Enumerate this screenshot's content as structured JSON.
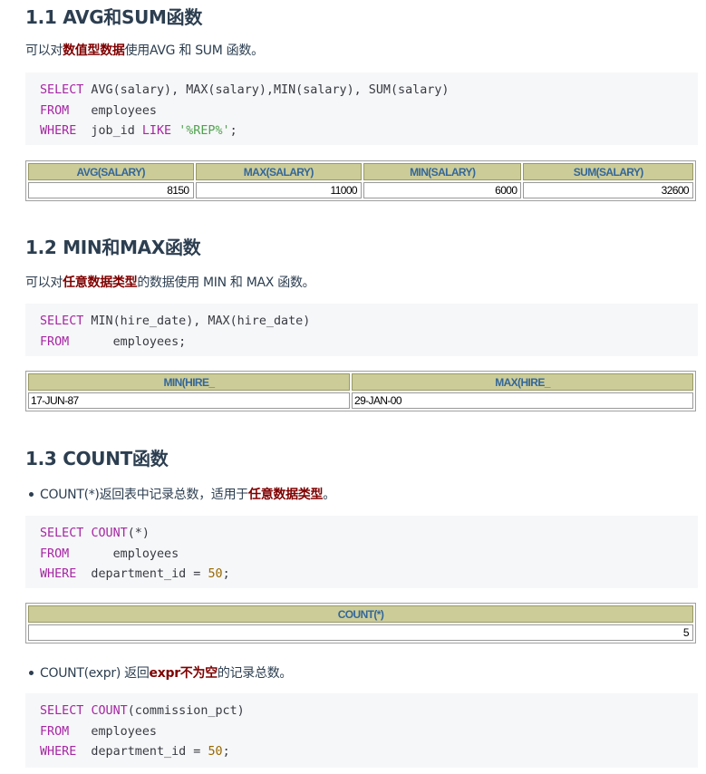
{
  "s1": {
    "heading": "1.1 AVG和SUM函数",
    "para_pre": "可以对",
    "para_hl": "数值型数据",
    "para_post": "使用AVG 和 SUM 函数。",
    "code": {
      "l1_kw": "SELECT",
      "l1_rest": " AVG(salary), MAX(salary),MIN(salary), SUM(salary)",
      "l2_kw": "FROM",
      "l2_rest": "   employees",
      "l3_kw": "WHERE",
      "l3_a": "  job_id ",
      "l3_kw2": "LIKE",
      "l3_sp": " ",
      "l3_str": "'%REP%'",
      "l3_end": ";"
    },
    "table": {
      "headers": [
        "AVG(SALARY)",
        "MAX(SALARY)",
        "MIN(SALARY)",
        "SUM(SALARY)"
      ],
      "row": [
        "8150",
        "11000",
        "6000",
        "32600"
      ]
    }
  },
  "s2": {
    "heading": "1.2 MIN和MAX函数",
    "para_pre": "可以对",
    "para_hl": "任意数据类型",
    "para_post": "的数据使用 MIN 和 MAX 函数。",
    "code": {
      "l1_kw": "SELECT",
      "l1_rest": " MIN(hire_date), MAX(hire_date)",
      "l2_kw": "FROM",
      "l2_rest": "      employees;"
    },
    "table": {
      "headers": [
        "MIN(HIRE_",
        "MAX(HIRE_"
      ],
      "row": [
        "17-JUN-87",
        "29-JAN-00"
      ]
    }
  },
  "s3": {
    "heading": "1.3 COUNT函数",
    "bullet1_pre": "COUNT(*)返回表中记录总数，适用于",
    "bullet1_hl": "任意数据类型",
    "bullet1_post": "。",
    "code1": {
      "l1_kw": "SELECT",
      "l1_sp": " ",
      "l1_fn": "COUNT",
      "l1_rest": "(*)",
      "l2_kw": "FROM",
      "l2_rest": "      employees",
      "l3_kw": "WHERE",
      "l3_a": "  department_id = ",
      "l3_num": "50",
      "l3_end": ";"
    },
    "table": {
      "headers": [
        "COUNT(*)"
      ],
      "row": [
        "5"
      ]
    },
    "bullet2_pre": "COUNT(expr) 返回",
    "bullet2_hl": "expr不为空",
    "bullet2_post": "的记录总数。",
    "code2": {
      "l1_kw": "SELECT",
      "l1_sp": " ",
      "l1_fn": "COUNT",
      "l1_rest": "(commission_pct)",
      "l2_kw": "FROM",
      "l2_rest": "   employees",
      "l3_kw": "WHERE",
      "l3_a": "  department_id = ",
      "l3_num": "50",
      "l3_end": ";"
    }
  }
}
